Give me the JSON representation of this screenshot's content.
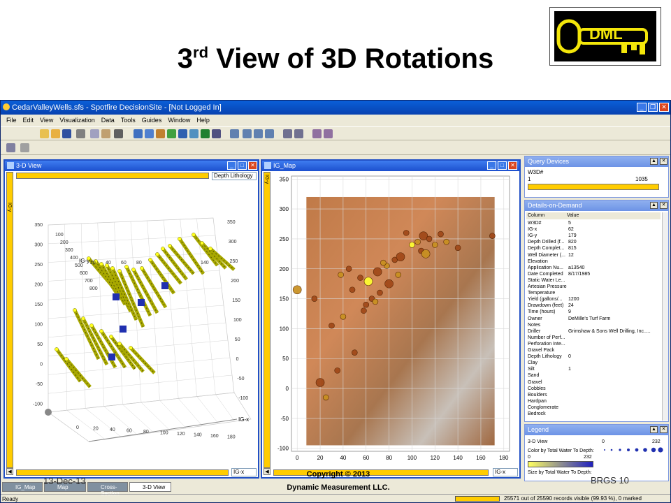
{
  "slide": {
    "title_main": "3",
    "title_sup": "rd",
    "title_rest": " View of 3D Rotations",
    "logo_text": "DML",
    "footer_date": "13-Dec-13",
    "footer_copyright": "Copyright © 2013",
    "footer_company": "Dynamic Measurement LLC.",
    "footer_page": "BRGS  10"
  },
  "app": {
    "title": "CedarValleyWells.sfs - Spotfire DecisionSite - [Not Logged In]",
    "menu": [
      "File",
      "Edit",
      "View",
      "Visualization",
      "Data",
      "Tools",
      "Guides",
      "Window",
      "Help"
    ],
    "status_left": "Ready",
    "status_records": "25571 out of 25590 records visible (99.93 %), 0 marked"
  },
  "view3d": {
    "title": "3-D View",
    "color_dropdown": "Depth Lithology",
    "x_axis_label": "IG-x",
    "y_axis_label": "IG-y",
    "x_ticks": [
      "0",
      "20",
      "40",
      "60",
      "80",
      "100",
      "120",
      "140",
      "160",
      "180"
    ],
    "z_ticks": [
      "350",
      "300",
      "250",
      "200",
      "150",
      "100",
      "50",
      "0",
      "-50",
      "-100"
    ],
    "y_ticks": [
      "100",
      "200",
      "300",
      "400",
      "500",
      "600",
      "700",
      "800"
    ],
    "top_ticks": [
      "20",
      "40",
      "60",
      "80",
      "140"
    ],
    "right_ticks": [
      "350",
      "300",
      "250",
      "200",
      "150",
      "100",
      "50",
      "0",
      "-50",
      "-100"
    ],
    "axis_side_label": "IG-y",
    "bottom_select": "IG-x"
  },
  "map": {
    "title": "IG_Map",
    "y_label": "IG-y",
    "y_ticks": [
      "350",
      "300",
      "250",
      "200",
      "150",
      "100",
      "50",
      "0",
      "-50",
      "-100"
    ],
    "x_ticks": [
      "0",
      "20",
      "40",
      "60",
      "80",
      "100",
      "120",
      "140",
      "160",
      "180"
    ],
    "bottom_select": "IG-x"
  },
  "query": {
    "title": "Query Devices",
    "field": "W3D#",
    "min": "1",
    "max": "1035"
  },
  "dod": {
    "title": "Details-on-Demand",
    "col_header": "Column",
    "val_header": "Value",
    "rows": [
      [
        "W3D#",
        "5"
      ],
      [
        "IG-x",
        "62"
      ],
      [
        "IG-y",
        "179"
      ],
      [
        "Depth Drilled (f...",
        "820"
      ],
      [
        "Depth Complet...",
        "815"
      ],
      [
        "Well Diameter (...",
        "12"
      ],
      [
        "Elevation",
        ""
      ],
      [
        "Application Nu...",
        "a13540"
      ],
      [
        "Date Completed",
        "8/17/1985"
      ],
      [
        "Static Water Le...",
        ""
      ],
      [
        "Artesian Pressure",
        ""
      ],
      [
        "Temperature",
        ""
      ],
      [
        "Yield (gallons/...",
        "1200"
      ],
      [
        "Drawdown (feet)",
        "24"
      ],
      [
        "Time (hours)",
        "9"
      ],
      [
        "Owner",
        "DeMille's Turf Farm"
      ],
      [
        "Notes",
        ""
      ],
      [
        "Driller",
        "Grimshaw & Sons Well Drilling, Inc....."
      ],
      [
        "Number of Perf...",
        ""
      ],
      [
        "Perforation Inte...",
        ""
      ],
      [
        "Gravel Pack",
        ""
      ],
      [
        "Depth Lithology",
        "0"
      ],
      [
        "Clay",
        ""
      ],
      [
        "Silt",
        "1"
      ],
      [
        "Sand",
        ""
      ],
      [
        "Gravel",
        ""
      ],
      [
        "Cobbles",
        ""
      ],
      [
        "Boulders",
        ""
      ],
      [
        "Hardpan",
        ""
      ],
      [
        "Conglomerate",
        ""
      ],
      [
        "Bedrock",
        ""
      ]
    ]
  },
  "legend": {
    "title": "Legend",
    "view": "3-D View",
    "color_by": "Color by Total Water To Depth:",
    "color_min": "0",
    "color_max": "232",
    "size_by": "Size by Total Water To Depth:",
    "size_min": "0",
    "size_max": "232"
  },
  "tabs": [
    "IG_Map",
    "Map",
    "Cross-Section",
    "3-D View"
  ],
  "chart_data": [
    {
      "type": "scatter",
      "title": "IG_Map",
      "ylabel": "IG-y",
      "xlabel": "IG-x",
      "xlim": [
        -5,
        185
      ],
      "ylim": [
        -105,
        355
      ],
      "x": [
        62,
        55,
        45,
        38,
        48,
        70,
        78,
        85,
        100,
        105,
        110,
        115,
        120,
        125,
        108,
        112,
        60,
        58,
        40,
        30,
        20,
        25,
        35,
        15,
        75,
        90,
        95,
        130,
        140,
        170,
        0,
        50,
        65,
        68,
        72,
        80,
        88
      ],
      "y": [
        179,
        185,
        200,
        190,
        165,
        195,
        205,
        215,
        240,
        245,
        255,
        250,
        240,
        258,
        230,
        225,
        140,
        130,
        120,
        105,
        10,
        -15,
        30,
        150,
        210,
        220,
        260,
        245,
        235,
        255,
        165,
        60,
        150,
        145,
        160,
        175,
        190
      ]
    }
  ]
}
